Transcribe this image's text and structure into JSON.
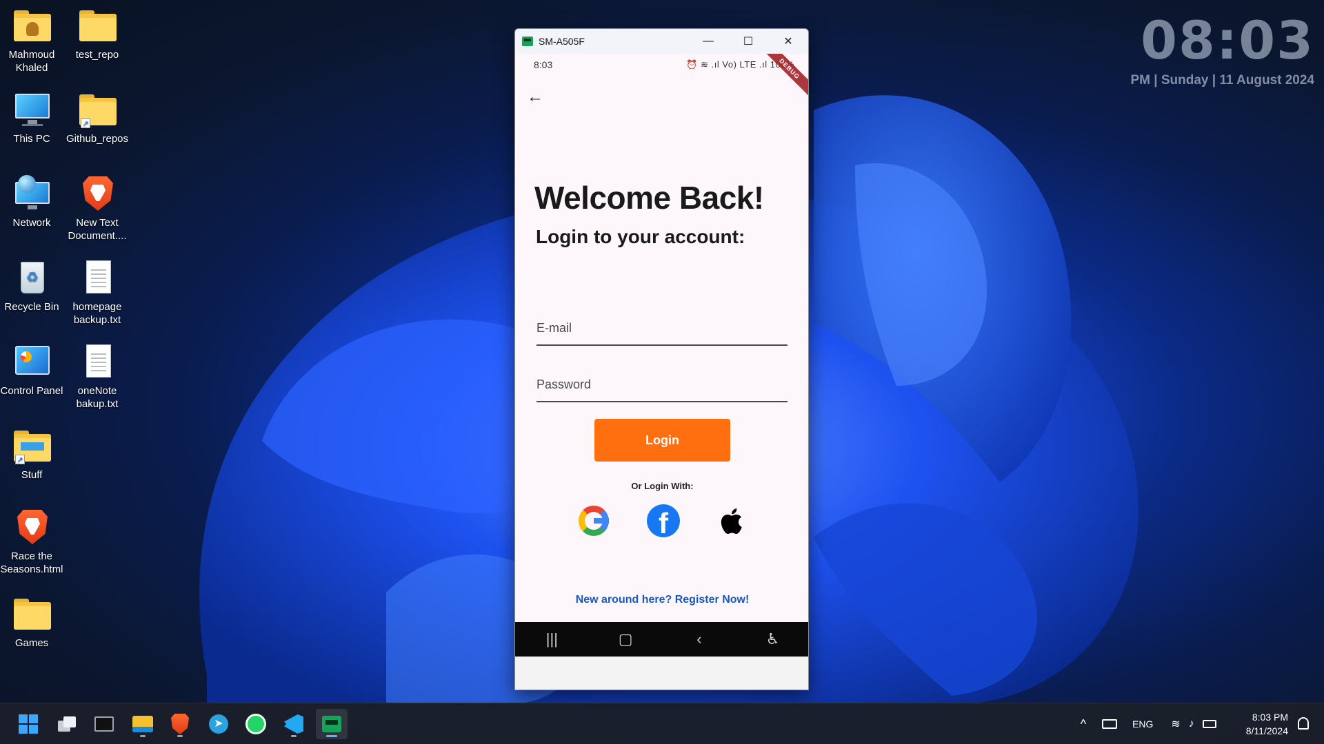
{
  "desktop": {
    "icons": [
      {
        "label": "Mahmoud Khaled",
        "icon": "user-folder-icon"
      },
      {
        "label": "test_repo",
        "icon": "folder-icon"
      },
      {
        "label": "This PC",
        "icon": "monitor-icon"
      },
      {
        "label": "Github_repos",
        "icon": "folder-shortcut-icon"
      },
      {
        "label": "Network",
        "icon": "network-icon"
      },
      {
        "label": "New Text Document....",
        "icon": "brave-browser-icon"
      },
      {
        "label": "Recycle Bin",
        "icon": "recycle-bin-icon"
      },
      {
        "label": "homepage backup.txt",
        "icon": "text-file-icon"
      },
      {
        "label": "Control Panel",
        "icon": "control-panel-icon"
      },
      {
        "label": "oneNote bakup.txt",
        "icon": "text-file-icon"
      },
      {
        "label": "Stuff",
        "icon": "folder-shortcut-icon"
      },
      {
        "label": "Race the Seasons.html",
        "icon": "brave-browser-icon"
      },
      {
        "label": "Games",
        "icon": "folder-icon"
      }
    ]
  },
  "clock_widget": {
    "time": "08:03",
    "date": "PM | Sunday | 11 August 2024"
  },
  "emulator": {
    "title": "SM-A505F",
    "controls": {
      "minimize": "—",
      "maximize": "☐",
      "close": "✕"
    },
    "status_bar": {
      "time": "8:03",
      "indicators": "⏰ ≋ .ıl Vo) LTE .ıl 100%",
      "debug_banner": "DEBUG"
    },
    "app": {
      "back_icon": "←",
      "title": "Welcome Back!",
      "subtitle": "Login to your account:",
      "email_placeholder": "E-mail",
      "password_placeholder": "Password",
      "login_label": "Login",
      "or_login_with": "Or Login With:",
      "social": [
        "google-icon",
        "facebook-icon",
        "apple-icon"
      ],
      "facebook_glyph": "f",
      "apple_glyph": "",
      "register_link": "New around here? Register Now!"
    },
    "nav_bar": {
      "recents": "|||",
      "home": "▢",
      "back": "‹",
      "accessibility": "♿"
    }
  },
  "taskbar": {
    "pinned": [
      "start-icon",
      "task-view-icon",
      "terminal-icon",
      "file-explorer-icon",
      "brave-icon",
      "telegram-icon",
      "whatsapp-icon",
      "vscode-icon",
      "android-studio-emulator-icon"
    ],
    "tray": {
      "chevron": "^",
      "language": "ENG",
      "time": "8:03 PM",
      "date": "8/11/2024"
    }
  },
  "colors": {
    "login_button": "#ff6f0f",
    "register_link": "#1758b8",
    "debug_banner": "#a3232a",
    "facebook": "#1877f2"
  }
}
